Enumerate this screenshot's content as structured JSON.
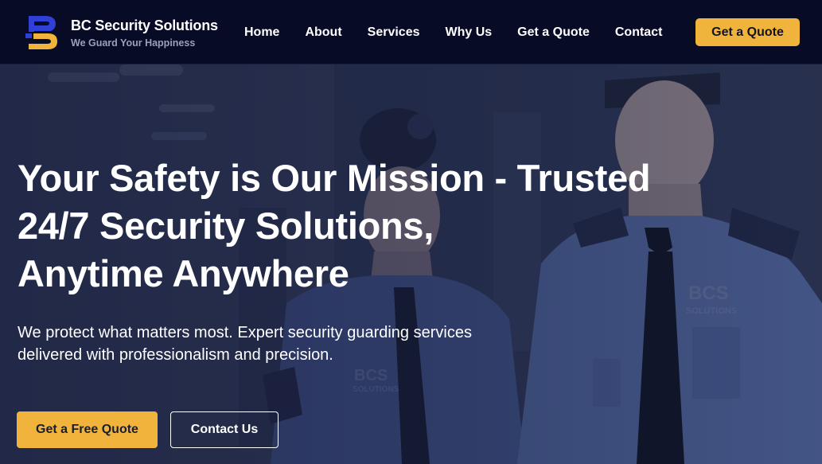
{
  "brand": {
    "name": "BC Security Solutions",
    "tagline": "We Guard Your Happiness",
    "logo_icon": "bc-logo-icon",
    "colors": {
      "blue": "#2f3fd8",
      "gold": "#f0b43c"
    }
  },
  "nav": {
    "items": [
      {
        "label": "Home"
      },
      {
        "label": "About"
      },
      {
        "label": "Services"
      },
      {
        "label": "Why Us"
      },
      {
        "label": "Get a Quote"
      },
      {
        "label": "Contact"
      }
    ],
    "cta_label": "Get a Quote"
  },
  "hero": {
    "title_lines": [
      "Your Safety is Our Mission - Trusted",
      "24/7 Security Solutions,",
      "Anytime Anywhere"
    ],
    "subtitle_lines": [
      "We protect what matters most. Expert security guarding services",
      "delivered with professionalism and precision."
    ],
    "primary_button": "Get a Free Quote",
    "secondary_button": "Contact Us",
    "badge_text": {
      "line1": "BCS",
      "line2": "SOLUTIONS"
    }
  },
  "colors": {
    "header_bg": "#070b26",
    "accent": "#f0b43c",
    "text": "#ffffff"
  }
}
